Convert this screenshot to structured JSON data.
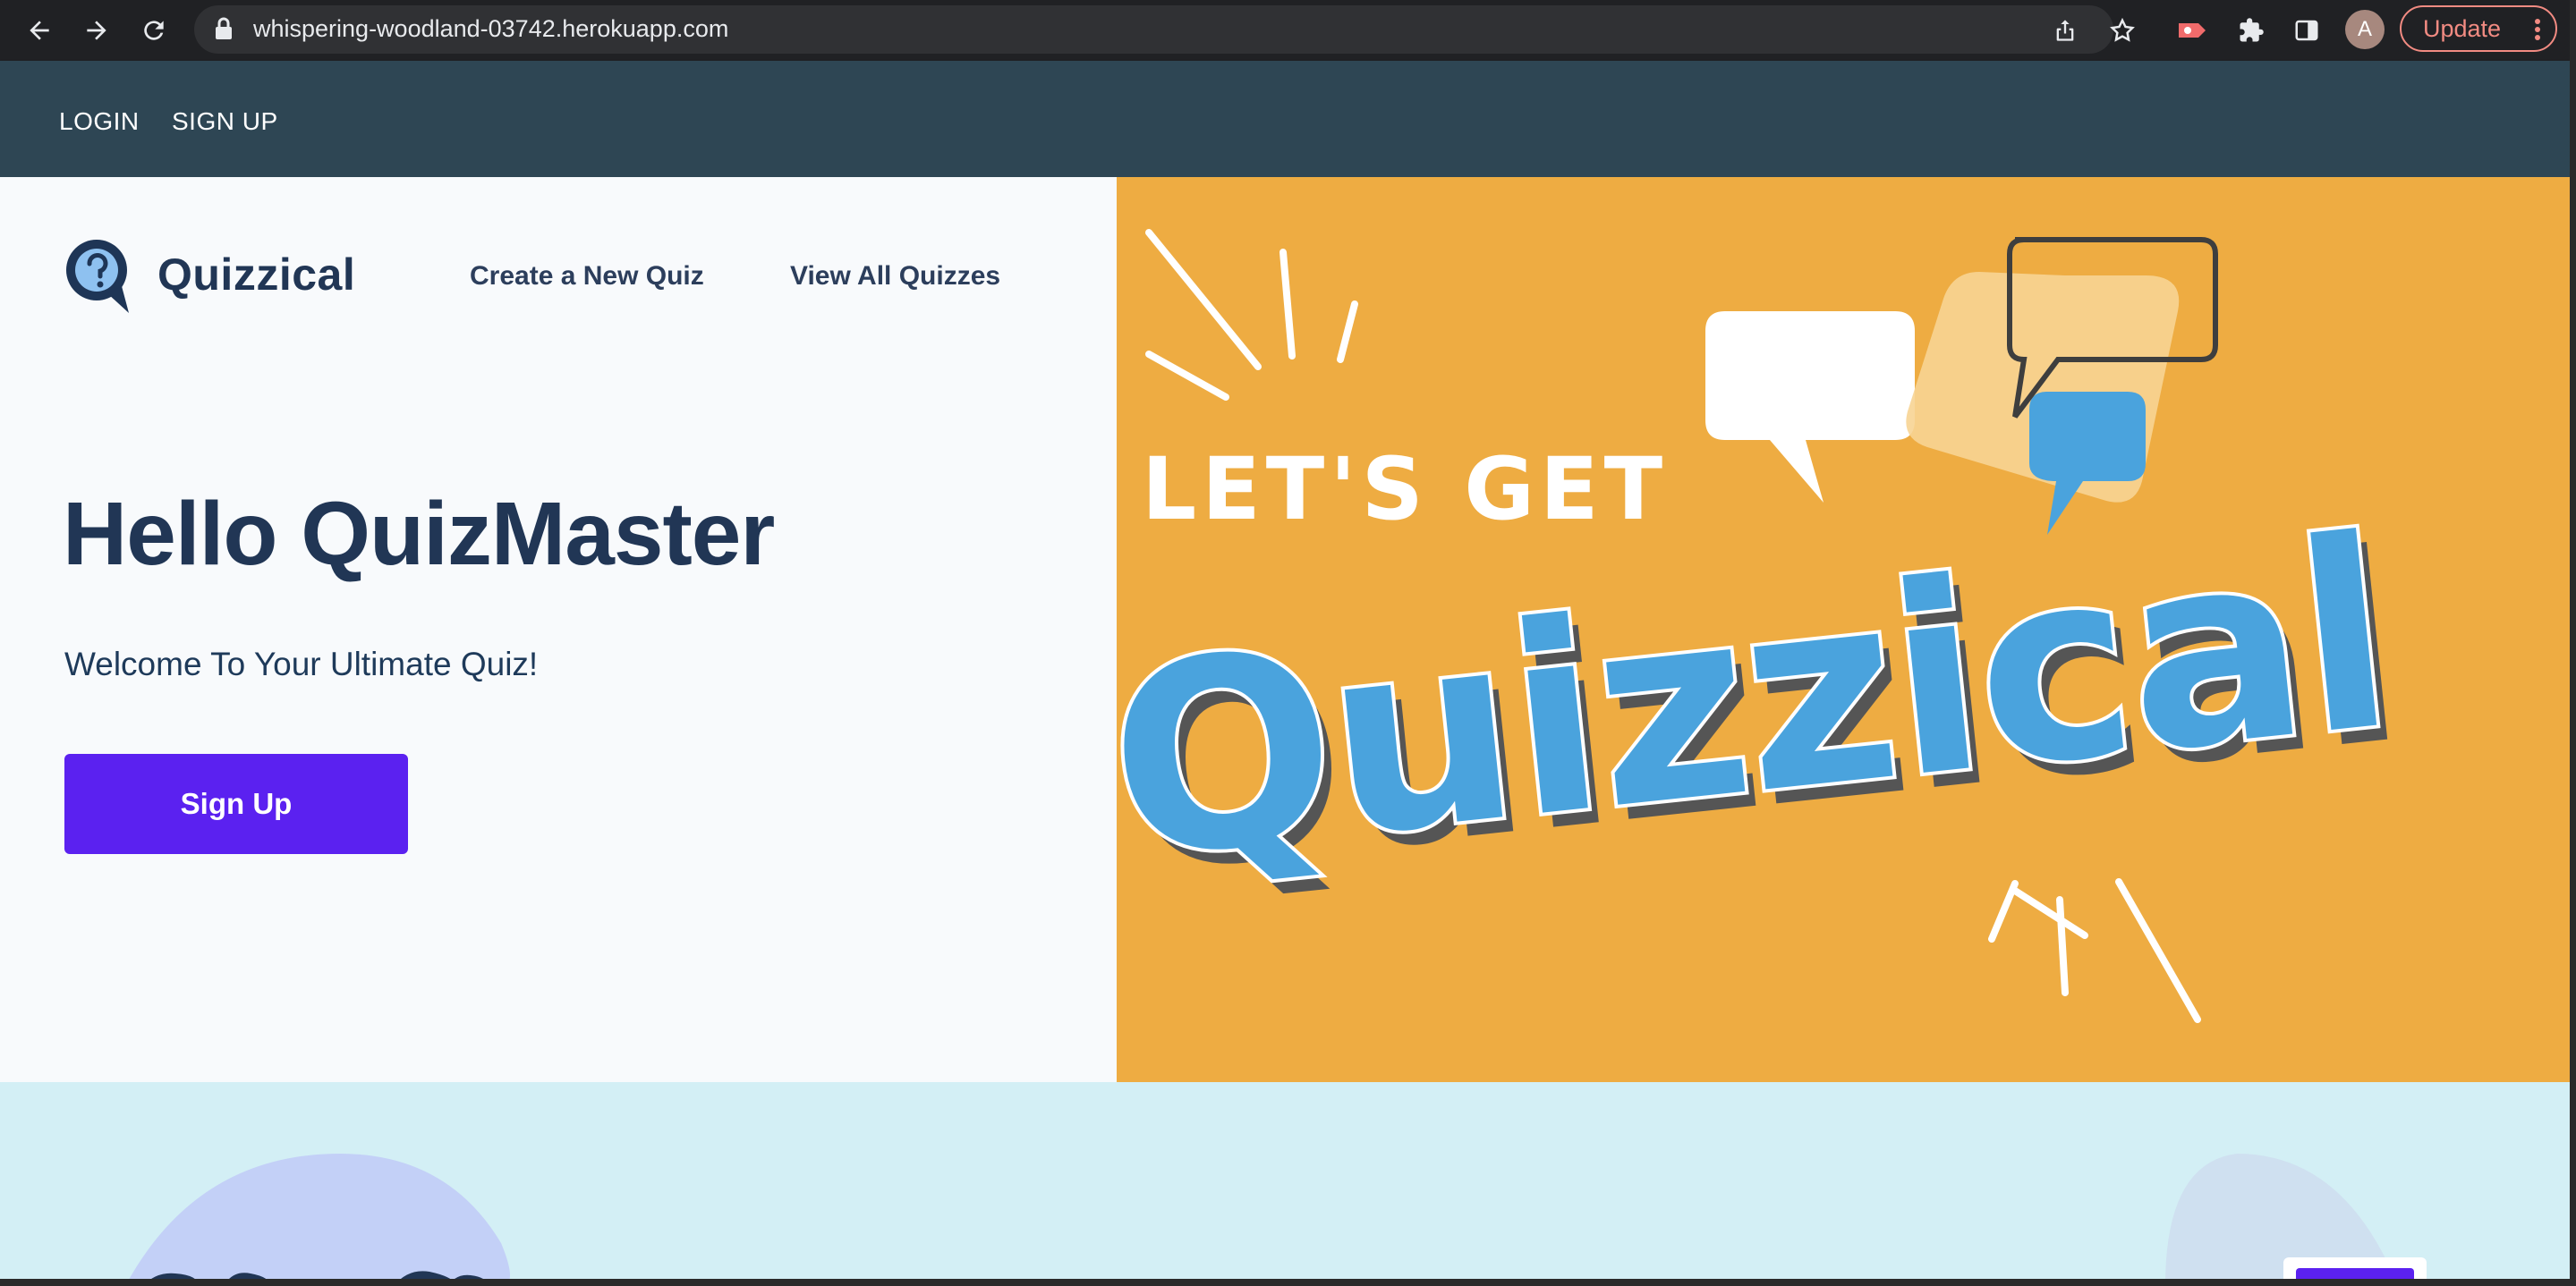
{
  "browser": {
    "url": "whispering-woodland-03742.herokuapp.com",
    "profile_initial": "A",
    "update_label": "Update"
  },
  "topbar": {
    "login_label": "LOGIN",
    "signup_label": "SIGN UP"
  },
  "site_header": {
    "brand": "Quizzical",
    "nav": [
      "Create a New Quiz",
      "View All Quizzes"
    ]
  },
  "hero": {
    "title": "Hello QuizMaster",
    "subtitle": "Welcome To Your Ultimate Quiz!",
    "cta_label": "Sign Up"
  },
  "banner": {
    "line1": "LET'S GET",
    "line2": "Quizzical"
  },
  "colors": {
    "topbar": "#2e4654",
    "primary": "#5b21f0",
    "banner_bg": "#eeac42",
    "navy": "#213655",
    "lower_bg": "#d3eff5"
  }
}
